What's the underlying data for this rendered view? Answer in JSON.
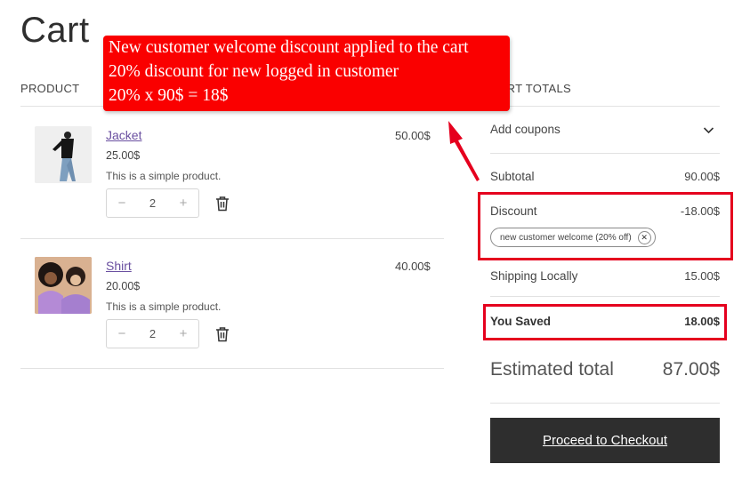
{
  "page": {
    "title": "Cart"
  },
  "columns": {
    "product": "PRODUCT",
    "totals": "CART TOTALS"
  },
  "items": [
    {
      "name": "Jacket",
      "unit_price": "25.00$",
      "description": "This is a simple product.",
      "quantity": "2",
      "line_total": "50.00$"
    },
    {
      "name": "Shirt",
      "unit_price": "20.00$",
      "description": "This is a simple product.",
      "quantity": "2",
      "line_total": "40.00$"
    }
  ],
  "stepper": {
    "minus": "−",
    "plus": "+"
  },
  "totals": {
    "coupons_label": "Add coupons",
    "subtotal_label": "Subtotal",
    "subtotal_value": "90.00$",
    "discount_label": "Discount",
    "discount_value": "-18.00$",
    "coupon_chip": "new customer welcome (20% off)",
    "shipping_label": "Shipping Locally",
    "shipping_value": "15.00$",
    "saved_label": "You Saved",
    "saved_value": "18.00$",
    "estimated_label": "Estimated total",
    "estimated_value": "87.00$",
    "checkout_label": "Proceed to Checkout"
  },
  "annotation": {
    "line1": "New customer welcome discount applied to the cart",
    "line2": "20% discount for new logged in customer",
    "line3": "20% x 90$ = 18$"
  },
  "colors": {
    "accent_red": "#fa0000",
    "link_purple": "#6a4fa0",
    "button_dark": "#2e2e2e"
  },
  "icons": [
    "trash-icon",
    "chevron-down-icon",
    "remove-coupon-icon",
    "arrow-pointer"
  ]
}
